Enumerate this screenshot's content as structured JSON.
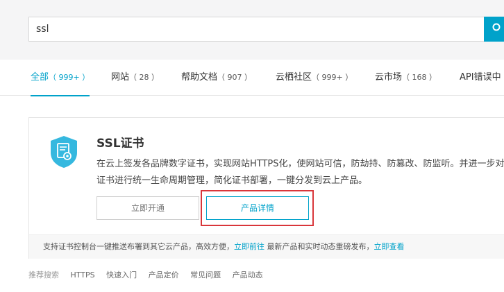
{
  "search": {
    "value": "ssl"
  },
  "tabs": [
    {
      "label": "全部",
      "count": "（ 999+ ）",
      "active": true
    },
    {
      "label": "网站",
      "count": "（ 28 ）"
    },
    {
      "label": "帮助文档",
      "count": "（ 907 ）"
    },
    {
      "label": "云栖社区",
      "count": "（ 999+ ）"
    },
    {
      "label": "云市场",
      "count": "（ 168 ）"
    },
    {
      "label": "API错误中",
      "count": ""
    }
  ],
  "product": {
    "title": "SSL证书",
    "description": "在云上签发各品牌数字证书，实现网站HTTPS化，使网站可信，防劫持、防篡改、防监听。并进一步对证书进行统一生命周期管理，简化证书部署，一键分发到云上产品。",
    "open_label": "立即开通",
    "detail_label": "产品详情",
    "footer_text": "支持证书控制台一键推送布署到其它云产品，高效方便，",
    "footer_link1": "立即前往",
    "footer_text2": " 最新产品和实时动态重磅发布，",
    "footer_link2": "立即查看"
  },
  "recommend": {
    "label": "推荐搜索",
    "items": [
      "HTTPS",
      "快速入门",
      "产品定价",
      "常见问题",
      "产品动态"
    ]
  },
  "colors": {
    "accent": "#00a2ca",
    "highlight": "#d9363a"
  }
}
